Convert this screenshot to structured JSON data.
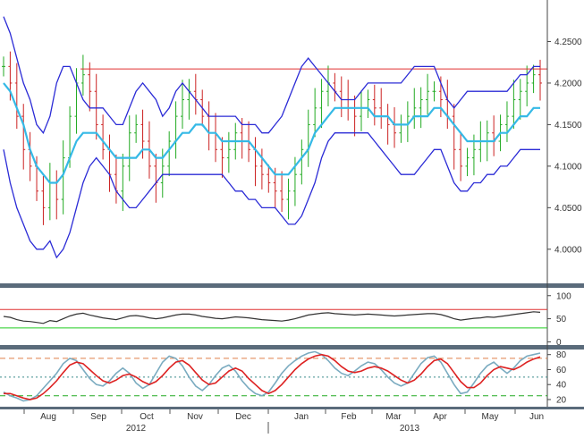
{
  "chart_data": [
    {
      "panel": "price",
      "type": "ohlc",
      "ylim": [
        3.96,
        4.3
      ],
      "yticks": [
        "4.0000",
        "4.0500",
        "4.1000",
        "4.1500",
        "4.2000",
        "4.2500"
      ],
      "ytick_values": [
        4.0,
        4.05,
        4.1,
        4.15,
        4.2,
        4.25
      ],
      "resistance_level": 4.217,
      "bars_close": [
        4.22,
        4.2,
        4.16,
        4.12,
        4.1,
        4.07,
        4.05,
        4.08,
        4.06,
        4.11,
        4.16,
        4.2,
        4.21,
        4.19,
        4.15,
        4.12,
        4.09,
        4.07,
        4.1,
        4.14,
        4.15,
        4.13,
        4.1,
        4.08,
        4.1,
        4.13,
        4.16,
        4.18,
        4.19,
        4.18,
        4.16,
        4.14,
        4.12,
        4.11,
        4.12,
        4.14,
        4.13,
        4.12,
        4.1,
        4.09,
        4.08,
        4.07,
        4.06,
        4.07,
        4.09,
        4.12,
        4.15,
        4.17,
        4.19,
        4.2,
        4.19,
        4.18,
        4.17,
        4.16,
        4.17,
        4.18,
        4.17,
        4.16,
        4.15,
        4.14,
        4.15,
        4.16,
        4.17,
        4.18,
        4.19,
        4.19,
        4.18,
        4.16,
        4.12,
        4.1,
        4.11,
        4.12,
        4.13,
        4.14,
        4.13,
        4.15,
        4.16,
        4.18,
        4.19,
        4.2,
        4.21,
        4.2
      ],
      "bollinger_mid": [
        4.2,
        4.19,
        4.17,
        4.15,
        4.12,
        4.1,
        4.09,
        4.08,
        4.08,
        4.09,
        4.11,
        4.13,
        4.14,
        4.14,
        4.14,
        4.13,
        4.12,
        4.11,
        4.11,
        4.11,
        4.11,
        4.12,
        4.12,
        4.11,
        4.11,
        4.12,
        4.13,
        4.14,
        4.14,
        4.15,
        4.15,
        4.14,
        4.14,
        4.13,
        4.13,
        4.13,
        4.13,
        4.13,
        4.12,
        4.11,
        4.1,
        4.09,
        4.09,
        4.09,
        4.1,
        4.11,
        4.12,
        4.14,
        4.15,
        4.16,
        4.17,
        4.17,
        4.17,
        4.17,
        4.17,
        4.17,
        4.16,
        4.16,
        4.16,
        4.15,
        4.15,
        4.15,
        4.16,
        4.16,
        4.16,
        4.17,
        4.17,
        4.16,
        4.15,
        4.14,
        4.13,
        4.13,
        4.13,
        4.13,
        4.13,
        4.14,
        4.14,
        4.15,
        4.16,
        4.16,
        4.17,
        4.17
      ],
      "bollinger_upper": [
        4.28,
        4.26,
        4.23,
        4.2,
        4.18,
        4.15,
        4.14,
        4.16,
        4.2,
        4.22,
        4.22,
        4.2,
        4.18,
        4.17,
        4.17,
        4.17,
        4.16,
        4.15,
        4.15,
        4.17,
        4.19,
        4.2,
        4.19,
        4.18,
        4.16,
        4.17,
        4.19,
        4.2,
        4.19,
        4.18,
        4.17,
        4.16,
        4.16,
        4.16,
        4.16,
        4.16,
        4.15,
        4.15,
        4.15,
        4.14,
        4.14,
        4.15,
        4.16,
        4.18,
        4.2,
        4.22,
        4.23,
        4.22,
        4.21,
        4.2,
        4.19,
        4.18,
        4.18,
        4.18,
        4.19,
        4.2,
        4.2,
        4.2,
        4.2,
        4.2,
        4.2,
        4.21,
        4.22,
        4.22,
        4.22,
        4.22,
        4.2,
        4.18,
        4.17,
        4.18,
        4.19,
        4.19,
        4.19,
        4.19,
        4.19,
        4.19,
        4.19,
        4.2,
        4.21,
        4.21,
        4.22,
        4.22
      ],
      "bollinger_lower": [
        4.12,
        4.08,
        4.05,
        4.03,
        4.01,
        4.0,
        4.0,
        4.01,
        3.99,
        4.0,
        4.02,
        4.05,
        4.08,
        4.1,
        4.11,
        4.1,
        4.09,
        4.07,
        4.06,
        4.05,
        4.05,
        4.06,
        4.07,
        4.08,
        4.09,
        4.09,
        4.09,
        4.09,
        4.09,
        4.09,
        4.09,
        4.09,
        4.09,
        4.09,
        4.08,
        4.07,
        4.07,
        4.06,
        4.06,
        4.05,
        4.05,
        4.05,
        4.04,
        4.03,
        4.03,
        4.04,
        4.06,
        4.08,
        4.11,
        4.13,
        4.14,
        4.14,
        4.14,
        4.14,
        4.14,
        4.14,
        4.13,
        4.12,
        4.11,
        4.1,
        4.09,
        4.09,
        4.09,
        4.1,
        4.11,
        4.12,
        4.12,
        4.1,
        4.08,
        4.07,
        4.07,
        4.08,
        4.08,
        4.09,
        4.09,
        4.1,
        4.1,
        4.11,
        4.12,
        4.12,
        4.12,
        4.12
      ]
    },
    {
      "panel": "rsi",
      "type": "line",
      "ylim": [
        -5,
        115
      ],
      "yticks": [
        "0",
        "50",
        "100"
      ],
      "ytick_values": [
        0,
        50,
        100
      ],
      "overbought": 70,
      "oversold": 30,
      "values": [
        55,
        53,
        48,
        45,
        44,
        42,
        40,
        46,
        44,
        50,
        56,
        60,
        62,
        58,
        55,
        52,
        50,
        48,
        52,
        56,
        57,
        55,
        52,
        50,
        52,
        55,
        58,
        60,
        60,
        58,
        55,
        53,
        51,
        50,
        52,
        54,
        53,
        52,
        50,
        48,
        47,
        46,
        45,
        47,
        50,
        54,
        58,
        60,
        62,
        63,
        61,
        60,
        59,
        58,
        59,
        60,
        59,
        58,
        57,
        56,
        57,
        58,
        59,
        60,
        61,
        61,
        59,
        55,
        50,
        47,
        49,
        51,
        52,
        54,
        53,
        55,
        57,
        59,
        61,
        63,
        65,
        64
      ]
    },
    {
      "panel": "stochastic",
      "type": "line",
      "ylim": [
        14,
        88
      ],
      "yticks": [
        "20",
        "40",
        "60",
        "80"
      ],
      "ytick_values": [
        20,
        40,
        60,
        80
      ],
      "levels": [
        25,
        50,
        75
      ],
      "series": [
        {
          "values": [
            30,
            25,
            22,
            18,
            20,
            25,
            35,
            45,
            55,
            68,
            75,
            72,
            60,
            48,
            40,
            38,
            45,
            55,
            62,
            55,
            42,
            35,
            40,
            55,
            70,
            78,
            75,
            65,
            50,
            38,
            32,
            40,
            52,
            62,
            66,
            58,
            45,
            35,
            28,
            25,
            30,
            42,
            55,
            65,
            72,
            78,
            82,
            84,
            80,
            72,
            62,
            55,
            52,
            58,
            65,
            70,
            68,
            60,
            50,
            42,
            38,
            42,
            55,
            68,
            76,
            78,
            70,
            55,
            40,
            28,
            30,
            42,
            55,
            65,
            70,
            62,
            55,
            62,
            72,
            78,
            80,
            82
          ]
        },
        {
          "values": [
            28,
            28,
            25,
            22,
            20,
            22,
            28,
            36,
            45,
            56,
            66,
            70,
            68,
            60,
            52,
            45,
            42,
            46,
            52,
            54,
            50,
            44,
            40,
            44,
            52,
            62,
            70,
            72,
            66,
            56,
            46,
            40,
            42,
            50,
            58,
            62,
            58,
            48,
            40,
            32,
            28,
            32,
            40,
            50,
            60,
            68,
            74,
            78,
            80,
            78,
            72,
            64,
            58,
            56,
            58,
            62,
            64,
            62,
            58,
            52,
            46,
            42,
            46,
            54,
            64,
            72,
            74,
            68,
            56,
            44,
            36,
            36,
            42,
            52,
            60,
            64,
            62,
            60,
            64,
            70,
            74,
            77
          ]
        }
      ]
    }
  ],
  "x_axis": {
    "months": [
      "Aug",
      "Sep",
      "Oct",
      "Nov",
      "Dec",
      "Jan",
      "Feb",
      "Mar",
      "Apr",
      "May",
      "Jun"
    ],
    "years": [
      "2012",
      "2013"
    ]
  },
  "colors": {
    "frame": "#5a6b7b",
    "ohlc_up": "#22aa22",
    "ohlc_down": "#cc2222",
    "bollinger": "#2b2bd6",
    "moving_average": "#35b9e6",
    "resistance": "#e03030",
    "rsi_line": "#333333",
    "rsi_upper": "#e03030",
    "rsi_lower": "#22cc22",
    "stoch_k": "#7aabc0",
    "stoch_d": "#dd2222",
    "stoch_outer_levels": "#e0804a",
    "stoch_lower_level": "#22aa22",
    "stoch_mid_level": "#3a8a8a"
  }
}
